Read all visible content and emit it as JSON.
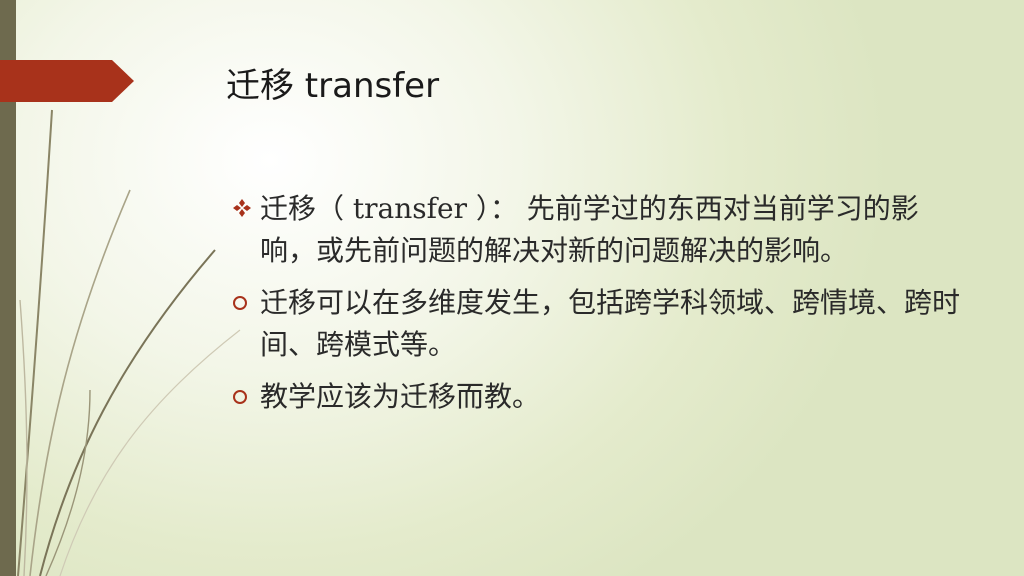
{
  "slide": {
    "title": "迁移 transfer",
    "bullets": [
      {
        "marker_icon": "diamond-bullet-icon",
        "text": "迁移（ transfer ）： 先前学过的东西对当前学习的影响，或先前问题的解决对新的问题解决的影响。"
      },
      {
        "marker_icon": "circle-bullet-icon",
        "text": "迁移可以在多维度发生，包括跨学科领域、跨情境、跨时间、跨模式等。"
      },
      {
        "marker_icon": "circle-bullet-icon",
        "text": "教学应该为迁移而教。"
      }
    ]
  },
  "colors": {
    "accent": "#a8321b",
    "bar": "#6e6a4e",
    "bullet": "#a8321b",
    "background": "#e4ebcc"
  }
}
